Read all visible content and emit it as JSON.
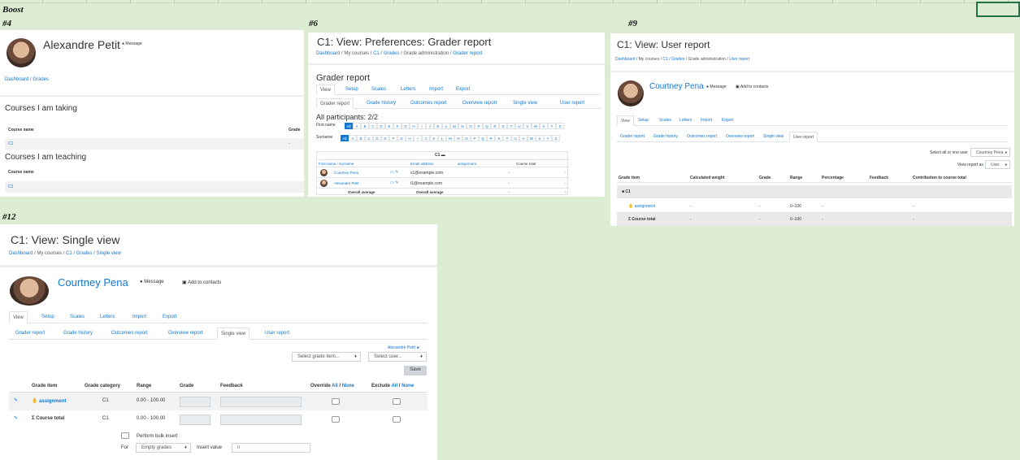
{
  "sheet": {
    "boost_label": "Boost",
    "labels": [
      "#4",
      "#6",
      "#9",
      "#12"
    ]
  },
  "p4": {
    "name": "Alexandre Petit",
    "message": "Message",
    "crumbs": [
      "Dashboard",
      "Grades"
    ],
    "taking_title": "Courses I am taking",
    "taking_cols": [
      "Course name",
      "Grade"
    ],
    "taking_rows": [
      {
        "course": "C1",
        "grade": "-"
      }
    ],
    "teaching_title": "Courses I am teaching",
    "teaching_cols": [
      "Course name"
    ],
    "teaching_rows": [
      {
        "course": "C1"
      }
    ]
  },
  "p6": {
    "title": "C1: View: Preferences: Grader report",
    "crumbs": [
      "Dashboard",
      "My courses",
      "C1",
      "Grades",
      "Grade administration",
      "Grader report"
    ],
    "section": "Grader report",
    "tabs": [
      "View",
      "Setup",
      "Scales",
      "Letters",
      "Import",
      "Export"
    ],
    "subtabs": [
      "Grader report",
      "Grade history",
      "Outcomes report",
      "Overview report",
      "Single view",
      "User report"
    ],
    "participants": "All participants: 2/2",
    "firstname_label": "First name",
    "surname_label": "Surname",
    "letters": [
      "All",
      "A",
      "B",
      "C",
      "D",
      "E",
      "F",
      "G",
      "H",
      "I",
      "J",
      "K",
      "L",
      "M",
      "N",
      "O",
      "P",
      "Q",
      "R",
      "S",
      "T",
      "U",
      "V",
      "W",
      "X",
      "Y",
      "Z"
    ],
    "course_col": "C1",
    "cols": [
      "First name / Surname",
      "Email address",
      "assignment",
      "Course total"
    ],
    "rows": [
      {
        "name": "Courtney Pena",
        "email": "s1@example.com",
        "a": "-",
        "t": "-"
      },
      {
        "name": "Alexandre Petit",
        "email": "t1@example.com",
        "a": "-",
        "t": "-"
      }
    ],
    "overall": "Overall average",
    "overall_vals": [
      "-",
      "-"
    ]
  },
  "p9": {
    "title": "C1: View: User report",
    "crumbs": [
      "Dashboard",
      "My courses",
      "C1",
      "Grades",
      "Grade administration",
      "User report"
    ],
    "name": "Courtney Pena",
    "message": "Message",
    "add_contacts": "Add to contacts",
    "tabs": [
      "View",
      "Setup",
      "Scales",
      "Letters",
      "Import",
      "Export"
    ],
    "subtabs": [
      "Grader report",
      "Grade history",
      "Outcomes report",
      "Overview report",
      "Single view",
      "User report"
    ],
    "select_all_label": "Select all or one user",
    "select_all_value": "Courtney Pena",
    "view_as_label": "View report as",
    "view_as_value": "User",
    "cols": [
      "Grade item",
      "Calculated weight",
      "Grade",
      "Range",
      "Percentage",
      "Feedback",
      "Contribution to course total"
    ],
    "category": "C1",
    "rows": [
      {
        "item": "assignment",
        "weight": "-",
        "grade": "-",
        "range": "0–100",
        "pct": "-",
        "contrib": "-"
      },
      {
        "item": "Course total",
        "weight": "-",
        "grade": "-",
        "range": "0–100",
        "pct": "-",
        "contrib": "-"
      }
    ]
  },
  "p12": {
    "title": "C1: View: Single view",
    "crumbs": [
      "Dashboard",
      "My courses",
      "C1",
      "Grades",
      "Single view"
    ],
    "name": "Courtney Pena",
    "message": "Message",
    "add_contacts": "Add to contacts",
    "tabs": [
      "View",
      "Setup",
      "Scales",
      "Letters",
      "Import",
      "Export"
    ],
    "subtabs": [
      "Grader report",
      "Grade history",
      "Outcomes report",
      "Overview report",
      "Single view",
      "User report"
    ],
    "next_user": "Alexandre Petit ►",
    "select_item": "Select grade item...",
    "select_user": "Select user...",
    "save": "Save",
    "cols": [
      "Grade item",
      "Grade category",
      "Range",
      "Grade",
      "Feedback",
      "Override",
      "Exclude"
    ],
    "all": "All",
    "none": "None",
    "rows": [
      {
        "item": "assignment",
        "category": "C1",
        "range": "0.00 - 100.00"
      },
      {
        "item": "Course total",
        "category": "C1",
        "range": "0.00 - 100.00"
      }
    ],
    "bulk_label": "Perform bulk insert",
    "for_label": "For",
    "for_value": "Empty grades",
    "insert_label": "Insert value",
    "insert_value": "0"
  }
}
